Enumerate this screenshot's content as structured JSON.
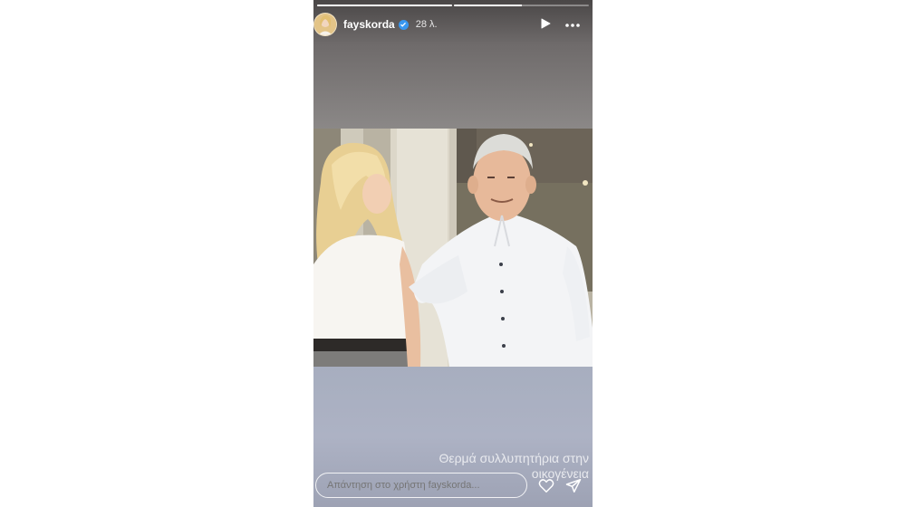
{
  "story": {
    "progress": [
      1.0,
      0.5
    ],
    "user": {
      "username": "fayskorda",
      "verified": true,
      "time_ago": "28 λ."
    },
    "caption": "Θερμά συλλυπητήρια στην οικογένεια",
    "reply_placeholder": "Απάντηση στο χρήστη fayskorda...",
    "icons": [
      "play-icon",
      "more-icon",
      "heart-icon",
      "send-icon",
      "verified-icon"
    ]
  },
  "colors": {
    "verified": "#3897f0",
    "bottom_band": "#aab0c2"
  }
}
